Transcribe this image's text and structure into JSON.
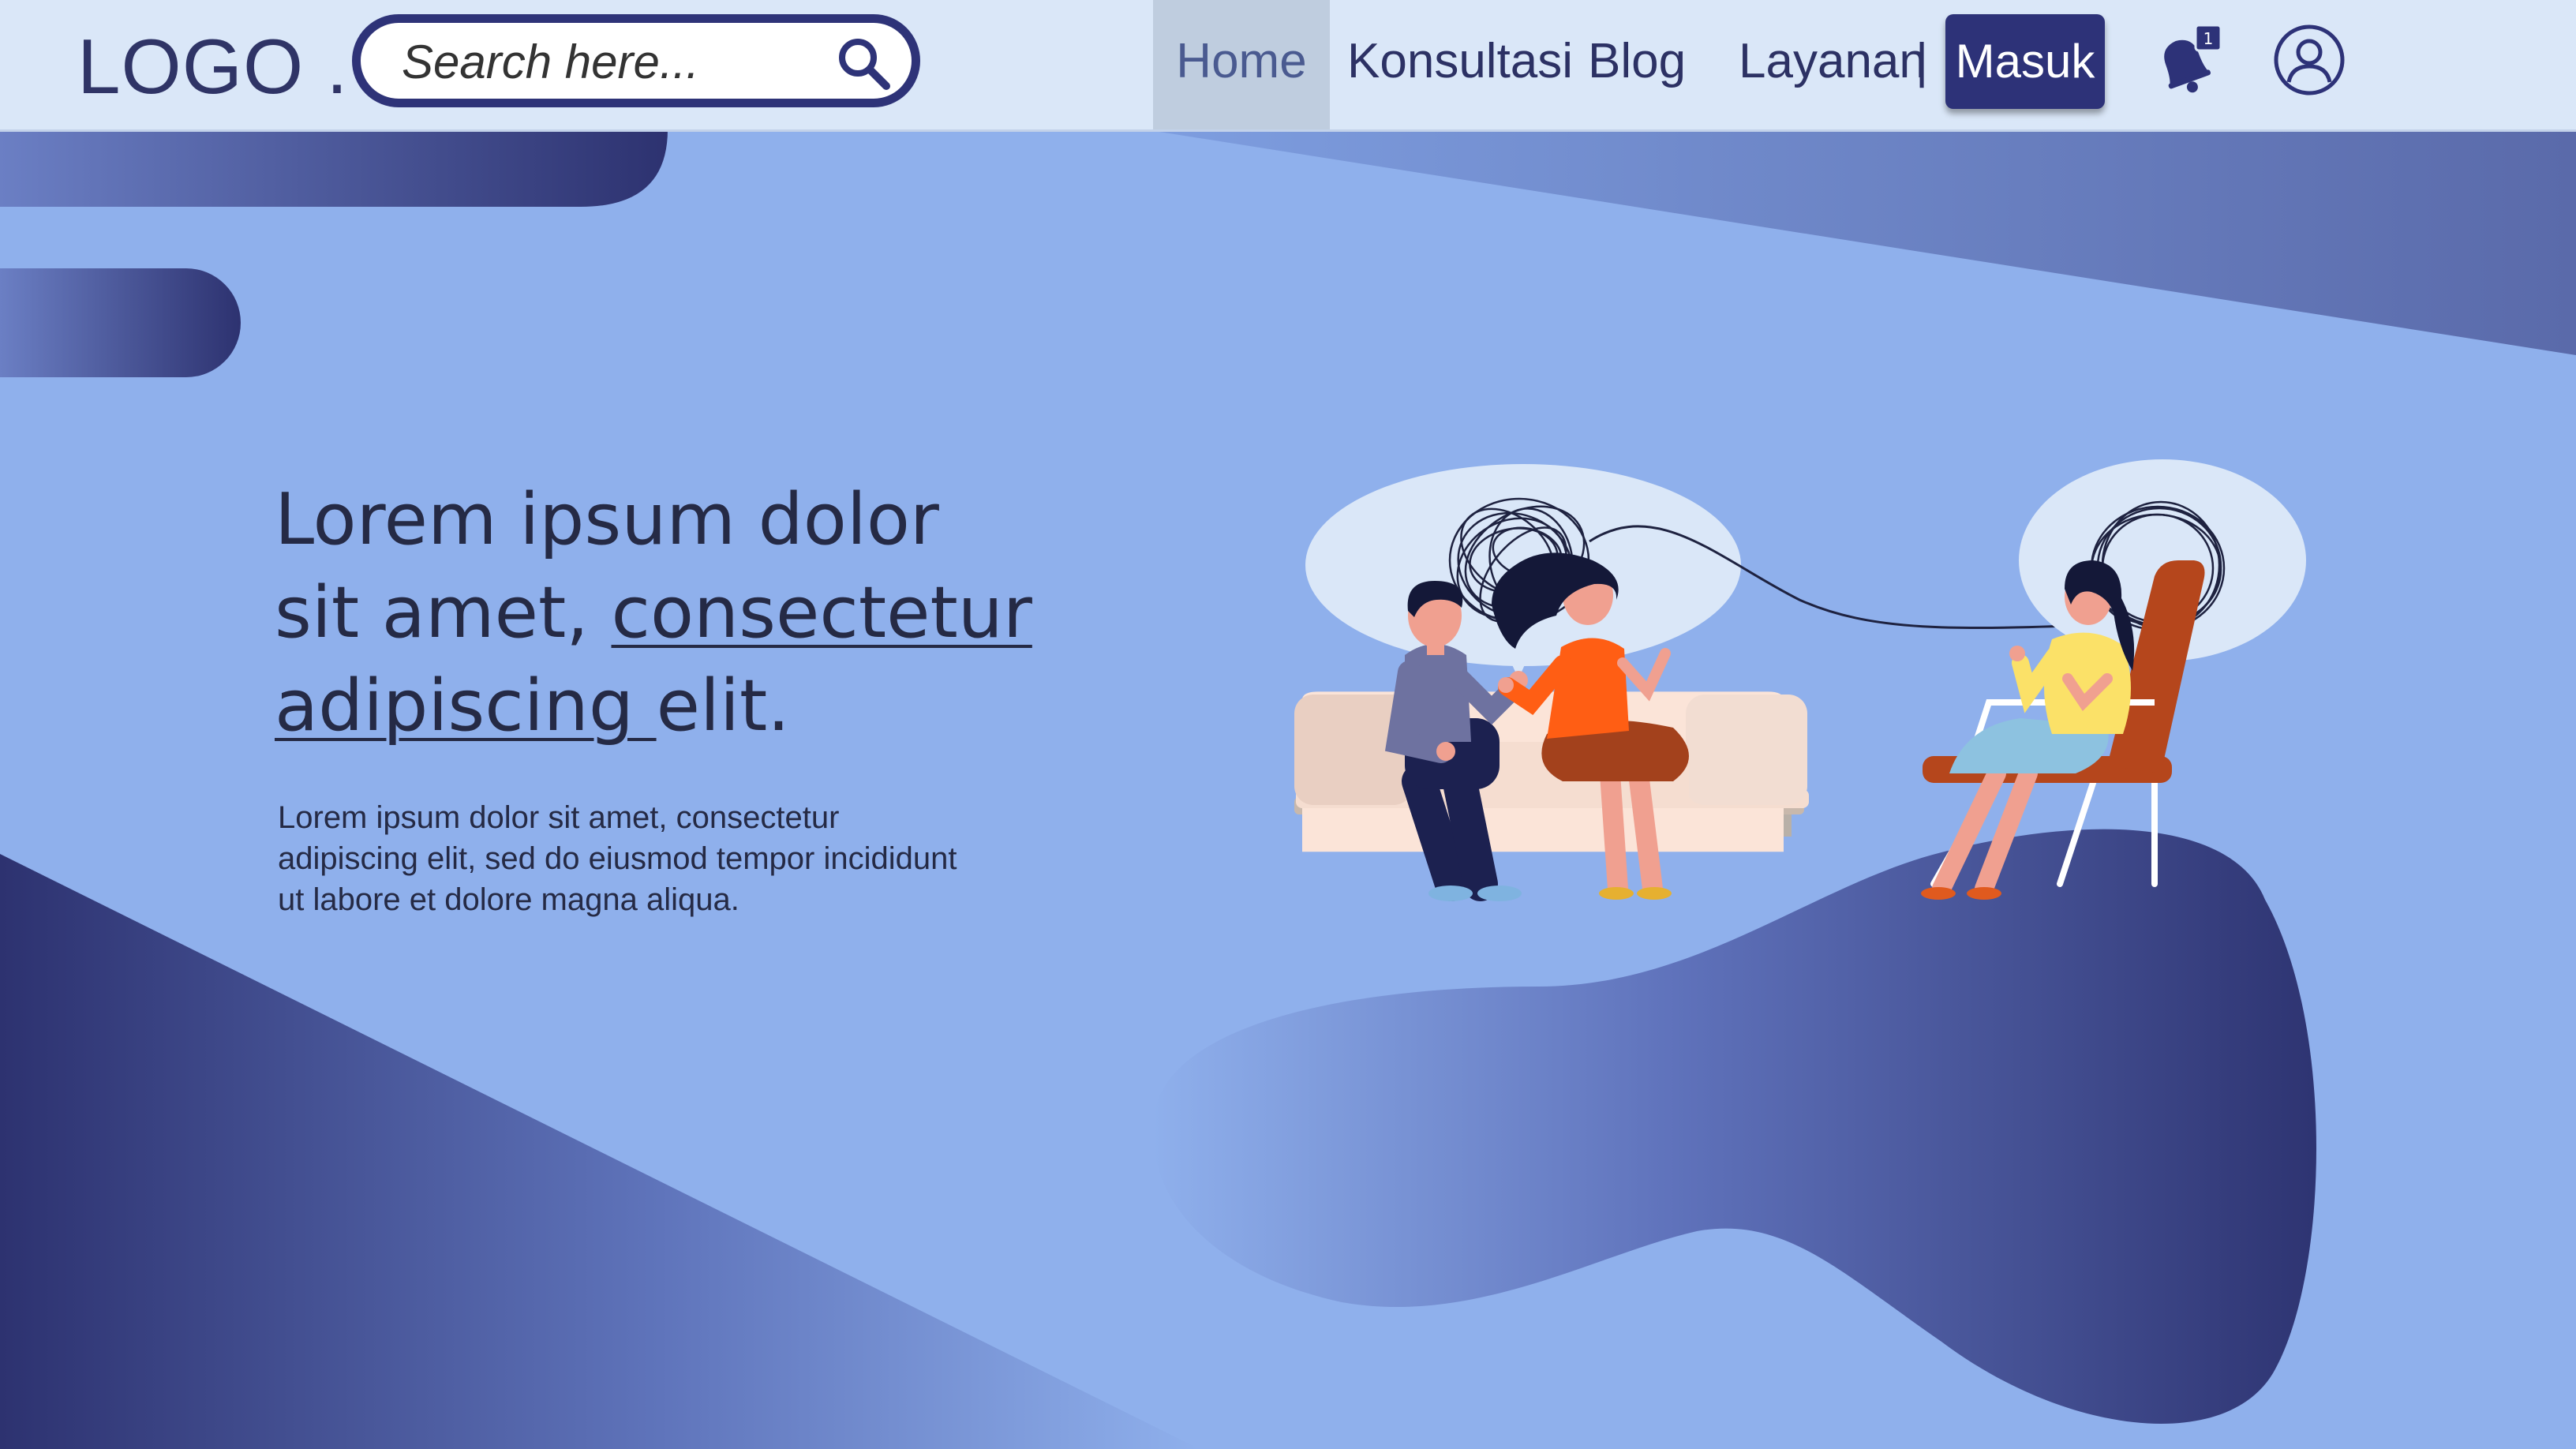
{
  "header": {
    "logo": "LOGO .",
    "search": {
      "placeholder": "Search here..."
    },
    "nav": [
      {
        "label": "Home",
        "active": true
      },
      {
        "label": "Konsultasi",
        "active": false
      },
      {
        "label": "Blog",
        "active": false
      },
      {
        "label": "Layanan",
        "active": false
      }
    ],
    "separator": "|",
    "login_label": "Masuk",
    "notification_count": "1"
  },
  "hero": {
    "title_plain_1": "Lorem ipsum dolor sit amet, ",
    "title_link": "consectetur adipiscing ",
    "title_plain_2": "elit.",
    "description": "Lorem ipsum dolor sit amet, consectetur adipiscing elit, sed do eiusmod tempor incididunt ut labore et dolore magna aliqua."
  },
  "colors": {
    "background": "#8fb0ec",
    "header_bg": "#dae7f8",
    "accent_dark": "#2d3278",
    "text_dark": "#252a45"
  },
  "icons": {
    "search": "search-icon",
    "notification": "bell-icon",
    "account": "user-circle-icon"
  }
}
